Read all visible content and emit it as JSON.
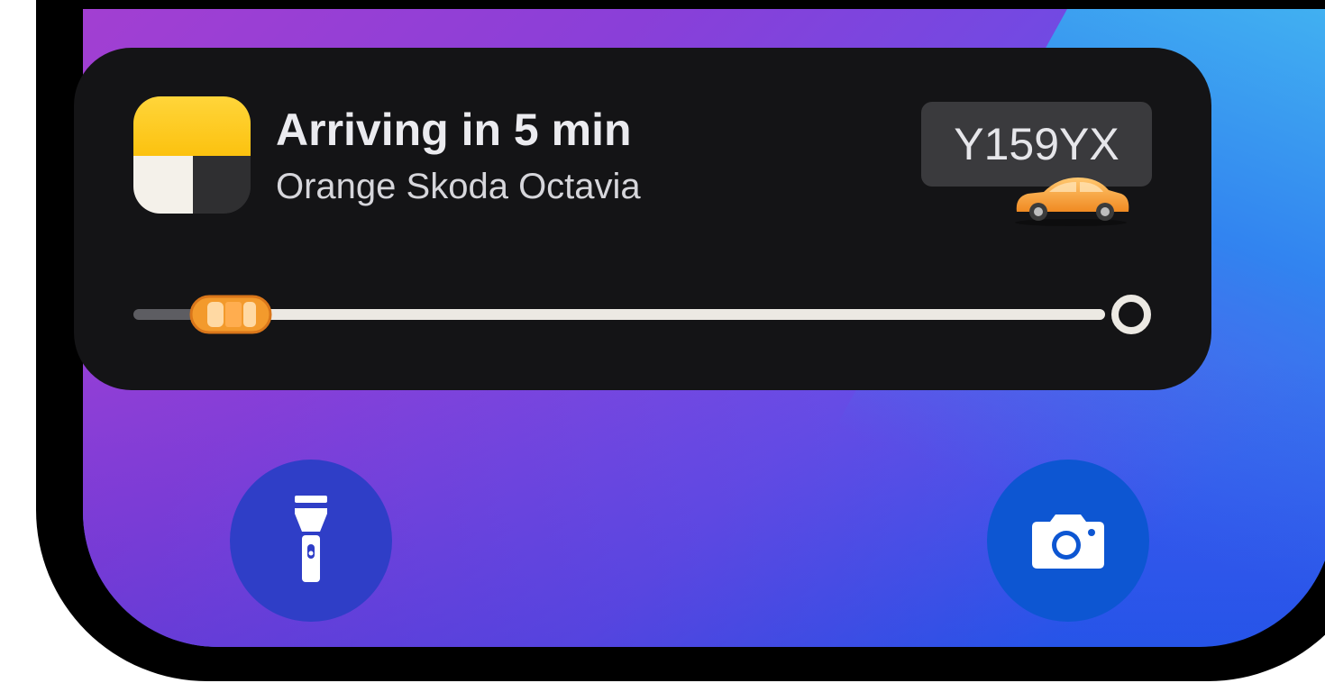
{
  "live_activity": {
    "app_icon": "yandex-go-app-icon",
    "title": "Arriving in 5 min",
    "subtitle": "Orange Skoda Octavia",
    "license_plate": "Y159YX",
    "car_icon": "orange-car-icon",
    "progress_fraction": 0.1,
    "destination_icon": "destination-ring-icon"
  },
  "quick_actions": {
    "left": {
      "icon": "flashlight-icon"
    },
    "right": {
      "icon": "camera-icon"
    }
  },
  "colors": {
    "card_background": "#141416",
    "track_fill": "#ece9e3",
    "track_empty": "#5d5d62",
    "car_orange": "#f39a2c",
    "brand_yellow": "#fcc20f"
  }
}
